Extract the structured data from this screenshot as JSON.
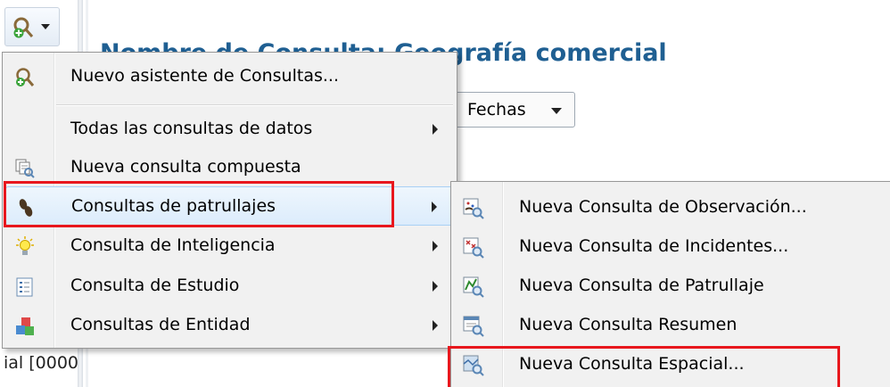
{
  "toolbar": {
    "query_button_icon": "query-add-icon",
    "dropdown_icon": "chevron-down-icon"
  },
  "page": {
    "title": "Nombre de Consulta: Geografía comercial",
    "date_select": "Fechas",
    "left_fragment": "ial [0000"
  },
  "main_menu": {
    "items": [
      {
        "label": "Nuevo asistente de Consultas...",
        "icon": "query-wizard-icon",
        "submenu": false
      },
      {
        "label": "Todas las consultas de datos",
        "icon": "",
        "submenu": true
      },
      {
        "label": "Nueva consulta compuesta",
        "icon": "compound-query-icon",
        "submenu": false
      },
      {
        "label": "Consultas de patrullajes",
        "icon": "footprints-icon",
        "submenu": true
      },
      {
        "label": "Consulta de Inteligencia",
        "icon": "lightbulb-icon",
        "submenu": true
      },
      {
        "label": "Consulta de Estudio",
        "icon": "list-icon",
        "submenu": true
      },
      {
        "label": "Consultas de Entidad",
        "icon": "cubes-icon",
        "submenu": true
      }
    ]
  },
  "sub_menu": {
    "items": [
      {
        "label": "Nueva Consulta de Observación...",
        "icon": "observation-query-icon"
      },
      {
        "label": "Nueva Consulta de Incidentes...",
        "icon": "incident-query-icon"
      },
      {
        "label": "Nueva Consulta de Patrullaje",
        "icon": "patrol-query-icon"
      },
      {
        "label": "Nueva Consulta Resumen",
        "icon": "summary-query-icon"
      },
      {
        "label": "Nueva Consulta Espacial...",
        "icon": "spatial-query-icon"
      }
    ]
  },
  "colors": {
    "title": "#1f5f92",
    "highlight_box": "#e8171d",
    "menu_bg": "#f1f1f1"
  }
}
